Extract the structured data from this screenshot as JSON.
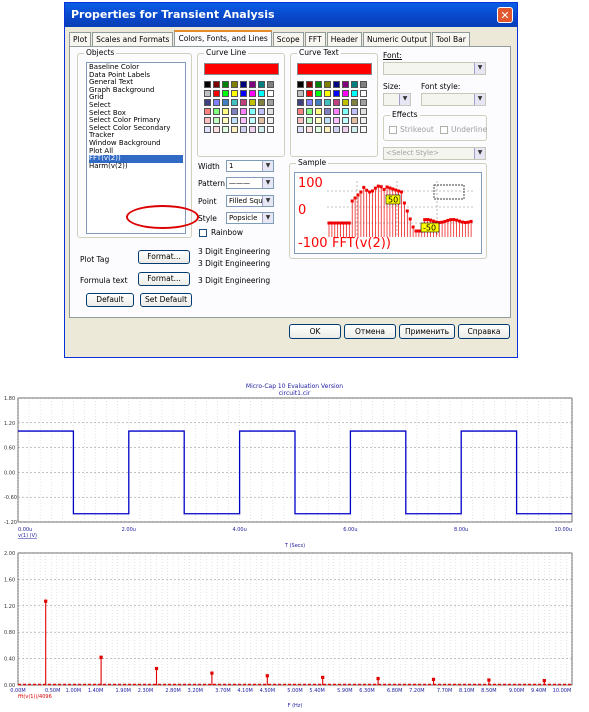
{
  "dialog": {
    "title": "Properties for Transient Analysis",
    "close_glyph": "✕",
    "tabs": [
      "Plot",
      "Scales and Formats",
      "Colors, Fonts, and Lines",
      "Scope",
      "FFT",
      "Header",
      "Numeric Output",
      "Tool Bar"
    ],
    "active_tab": "Colors, Fonts, and Lines",
    "objects": {
      "label": "Objects",
      "items": [
        "Baseline Color",
        "Data Point Labels",
        "General Text",
        "Graph Background",
        "Grid",
        "Select",
        "Select Box",
        "Select Color Primary",
        "Select Color Secondary",
        "Tracker",
        "Window Background",
        "Plot All",
        "FFT(v(2))",
        "Harm(v(2))"
      ],
      "selected": "FFT(v(2))"
    },
    "curve_line": {
      "label": "Curve Line",
      "color": "#FF0000",
      "width_label": "Width",
      "width_value": "1",
      "pattern_label": "Pattern",
      "pattern_value": "———",
      "point_label": "Point",
      "point_value": "Filled Squa",
      "style_label": "Style",
      "style_value": "Popsicle",
      "rainbow_label": "Rainbow"
    },
    "curve_text": {
      "label": "Curve Text",
      "color": "#FF0000"
    },
    "font": {
      "font_label": "Font:",
      "size_label": "Size:",
      "style_label": "Font style:",
      "effects_label": "Effects",
      "strikeout_label": "Strikeout",
      "underline_label": "Underline",
      "select_style": "<Select Style>"
    },
    "sample": {
      "label": "Sample",
      "top_value": "100",
      "mid_value": "0",
      "bottom_value": "-100",
      "curve_name": "FFT(v(2))",
      "box_50": "50",
      "box_neg50": "-50"
    },
    "plot_tag": {
      "label": "Plot Tag",
      "button": "Format...",
      "value": "3 Digit Engineering"
    },
    "formula_text": {
      "label": "Formula text",
      "button": "Format...",
      "value": "3 Digit Engineering"
    },
    "extra_value": "3 Digit Engineering",
    "default_button": "Default",
    "set_default_button": "Set Default",
    "ok_button": "OK",
    "cancel_button": "Отмена",
    "apply_button": "Применить",
    "help_button": "Справка"
  },
  "plot": {
    "title": "Micro-Cap 10 Evaluation Version",
    "subtitle": "circuit1.cir",
    "top": {
      "y_ticks": [
        "1.80",
        "1.20",
        "0.60",
        "0.00",
        "-0.60",
        "-1.20"
      ],
      "x_ticks": [
        "0.00u",
        "2.00u",
        "4.00u",
        "6.00u",
        "8.00u",
        "10.00u"
      ],
      "trace_label": "v(1) (V)",
      "xlabel": "T (Secs)",
      "trace_color": "#0000C8"
    },
    "bottom": {
      "y_ticks": [
        "2.00",
        "1.60",
        "1.20",
        "0.80",
        "0.40",
        "0.00"
      ],
      "x_ticks": [
        "0.00M",
        "0.50M",
        "1.00M",
        "1.40M",
        "1.90M",
        "2.30M",
        "2.80M",
        "3.20M",
        "3.70M",
        "4.10M",
        "4.50M",
        "5.00M",
        "5.40M",
        "5.90M",
        "6.30M",
        "6.80M",
        "7.20M",
        "7.70M",
        "8.10M",
        "8.50M",
        "9.00M",
        "9.40M",
        "10.00M"
      ],
      "trace_label": "fft(v(1))/4096",
      "xlabel": "F (Hz)",
      "trace_color": "#E00000"
    }
  },
  "chart_data": [
    {
      "type": "line",
      "title": "Micro-Cap 10 Evaluation Version",
      "xlabel": "T (Secs)",
      "ylabel": "",
      "xlim": [
        0,
        10
      ],
      "ylim": [
        -1.2,
        1.8
      ],
      "series": [
        {
          "name": "v(1) (V)",
          "x_unit": "us",
          "x": [
            0,
            0,
            1,
            1,
            2,
            2,
            3,
            3,
            4,
            4,
            5,
            5,
            6,
            6,
            7,
            7,
            8,
            8,
            9,
            9,
            10
          ],
          "y": [
            1,
            1,
            1,
            -1,
            -1,
            1,
            1,
            -1,
            -1,
            1,
            1,
            -1,
            -1,
            1,
            1,
            -1,
            -1,
            1,
            1,
            -1,
            -1
          ]
        }
      ],
      "grid": true
    },
    {
      "type": "bar",
      "title": "",
      "xlabel": "F (Hz)",
      "ylabel": "",
      "xlim": [
        0,
        10
      ],
      "ylim": [
        0,
        2
      ],
      "series": [
        {
          "name": "fft(v(1))/4096",
          "x_unit": "MHz",
          "x": [
            0.5,
            1.5,
            2.5,
            3.5,
            4.5,
            5.5,
            6.5,
            7.5,
            8.5,
            9.5
          ],
          "y": [
            1.27,
            0.42,
            0.25,
            0.18,
            0.14,
            0.115,
            0.098,
            0.085,
            0.075,
            0.067
          ]
        }
      ],
      "grid": true
    }
  ]
}
